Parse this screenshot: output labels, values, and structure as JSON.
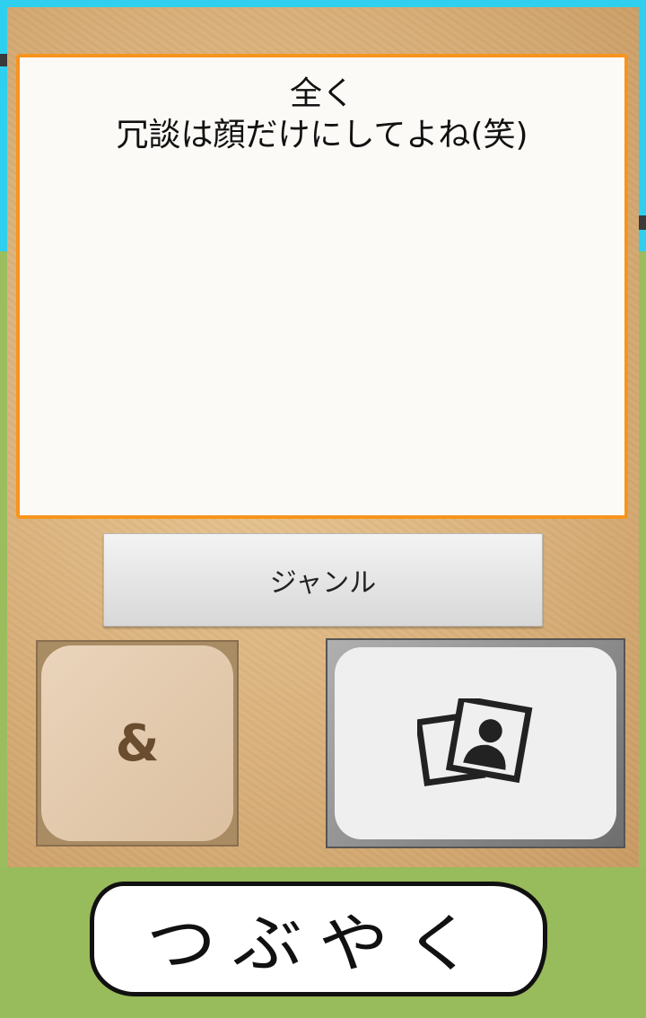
{
  "message": {
    "text": "全く\n冗談は顔だけにしてよね(笑)"
  },
  "genre_button": {
    "label": "ジャンル"
  },
  "and_button": {
    "label": "&"
  },
  "photo_button": {
    "icon": "photo-gallery-icon"
  },
  "tweet_button": {
    "label": "つぶやく"
  },
  "colors": {
    "sky": "#2fd0ef",
    "grass": "#9bbd5e",
    "message_border": "#f7941d",
    "panel": "#d9b07a"
  }
}
